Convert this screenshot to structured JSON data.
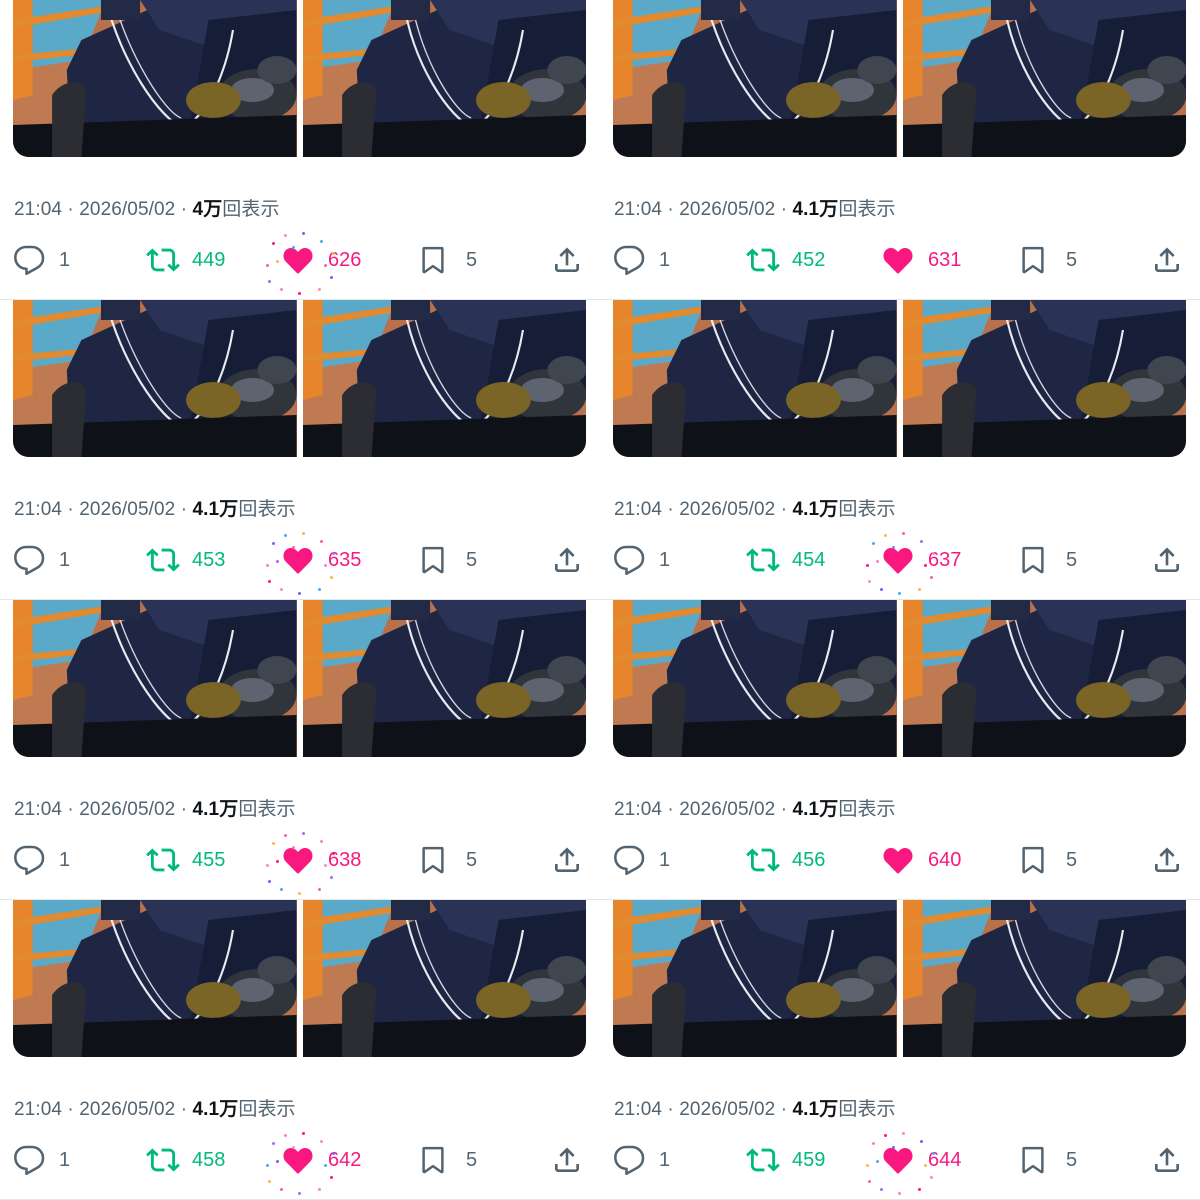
{
  "colors": {
    "retweet": "#00ba7c",
    "like": "#f91880",
    "muted": "#536471",
    "text": "#0f1419",
    "divider": "#e3e7ea"
  },
  "icons": {
    "reply": "speech-bubble-icon",
    "retweet": "retweet-arrows-icon",
    "like": "heart-filled-icon",
    "bookmark": "bookmark-icon",
    "share": "share-upload-icon"
  },
  "posts": [
    {
      "time": "21:04",
      "date": "2026/05/02",
      "views_num": "4",
      "views_unit": "万",
      "views_label": "回表示",
      "replies": "1",
      "retweets": "449",
      "likes": "626",
      "bookmarks": "5",
      "sparkles": true
    },
    {
      "time": "21:04",
      "date": "2026/05/02",
      "views_num": "4.1",
      "views_unit": "万",
      "views_label": "回表示",
      "replies": "1",
      "retweets": "452",
      "likes": "631",
      "bookmarks": "5",
      "sparkles": false
    },
    {
      "time": "21:04",
      "date": "2026/05/02",
      "views_num": "4.1",
      "views_unit": "万",
      "views_label": "回表示",
      "replies": "1",
      "retweets": "453",
      "likes": "635",
      "bookmarks": "5",
      "sparkles": true
    },
    {
      "time": "21:04",
      "date": "2026/05/02",
      "views_num": "4.1",
      "views_unit": "万",
      "views_label": "回表示",
      "replies": "1",
      "retweets": "454",
      "likes": "637",
      "bookmarks": "5",
      "sparkles": true
    },
    {
      "time": "21:04",
      "date": "2026/05/02",
      "views_num": "4.1",
      "views_unit": "万",
      "views_label": "回表示",
      "replies": "1",
      "retweets": "455",
      "likes": "638",
      "bookmarks": "5",
      "sparkles": true
    },
    {
      "time": "21:04",
      "date": "2026/05/02",
      "views_num": "4.1",
      "views_unit": "万",
      "views_label": "回表示",
      "replies": "1",
      "retweets": "456",
      "likes": "640",
      "bookmarks": "5",
      "sparkles": false
    },
    {
      "time": "21:04",
      "date": "2026/05/02",
      "views_num": "4.1",
      "views_unit": "万",
      "views_label": "回表示",
      "replies": "1",
      "retweets": "458",
      "likes": "642",
      "bookmarks": "5",
      "sparkles": true
    },
    {
      "time": "21:04",
      "date": "2026/05/02",
      "views_num": "4.1",
      "views_unit": "万",
      "views_label": "回表示",
      "replies": "1",
      "retweets": "459",
      "likes": "644",
      "bookmarks": "5",
      "sparkles": true
    }
  ]
}
